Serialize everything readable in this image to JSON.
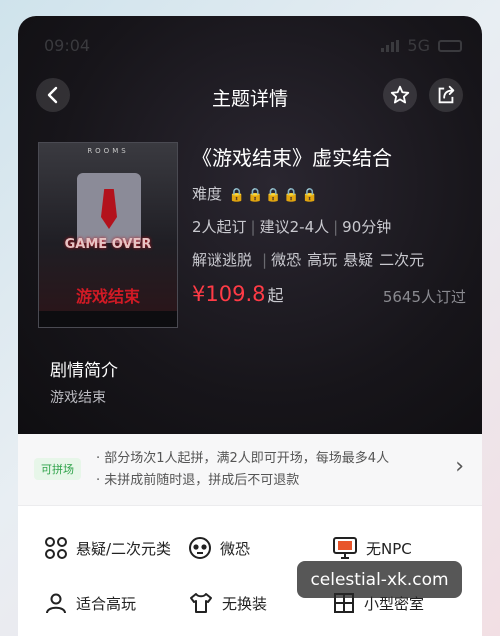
{
  "status": {
    "time": "09:04",
    "network": "5G"
  },
  "nav": {
    "title": "主题详情"
  },
  "cover": {
    "top_text": "ROOMS",
    "game_over": "GAME OVER",
    "cn_title": "游戏结束"
  },
  "theme": {
    "title": "《游戏结束》虚实结合",
    "difficulty_label": "难度",
    "difficulty_level": 5,
    "players_min": "2人起订",
    "players_suggest": "建议2-4人",
    "duration": "90分钟",
    "tags": [
      "解谜逃脱",
      "微恐",
      "高玩",
      "悬疑",
      "二次元"
    ],
    "price": "¥109.8",
    "price_suffix": "起",
    "booked": "5645人订过"
  },
  "plot": {
    "heading": "剧情简介",
    "summary": "游戏结束"
  },
  "pin": {
    "badge": "可拼场",
    "line1": "· 部分场次1人起拼，满2人即可开场，每场最多4人",
    "line2": "· 未拼成前随时退，拼成后不可退款"
  },
  "features": [
    {
      "label": "悬疑/二次元类",
      "icon": "category-icon"
    },
    {
      "label": "微恐",
      "icon": "ghost-icon"
    },
    {
      "label": "无NPC",
      "icon": "monitor-icon"
    },
    {
      "label": "适合高玩",
      "icon": "person-icon"
    },
    {
      "label": "无换装",
      "icon": "shirt-icon"
    },
    {
      "label": "小型密室",
      "icon": "room-icon"
    }
  ],
  "watermark": "celestial-xk.com",
  "colors": {
    "price": "#ff3b46",
    "lock": "#e9b13b",
    "badge_green": "#2fa34a"
  }
}
